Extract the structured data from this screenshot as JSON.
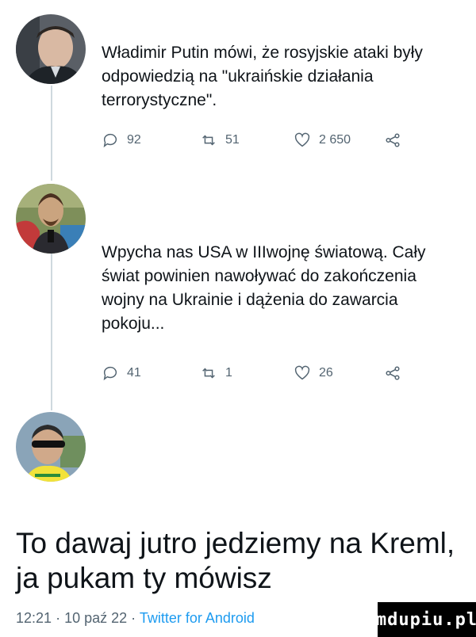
{
  "tweets": [
    {
      "text": "Władimir Putin mówi, że rosyjskie ataki były odpowiedzią na \"ukraińskie działania terrorystyczne\".",
      "replies": "92",
      "retweets": "51",
      "likes": "2 650",
      "share_icon": "share-icon"
    },
    {
      "text": "Wpycha nas USA w IIIwojnę światową. Cały świat powinien nawoływać do zakończenia wojny na Ukrainie i dążenia do zawarcia pokoju...",
      "replies": "41",
      "retweets": "1",
      "likes": "26",
      "share_icon": "share-icon"
    }
  ],
  "reply": {
    "text": "To dawaj jutro jedziemy na Kreml, ja pukam ty mówisz",
    "time": "12:21",
    "date": "10 paź 22",
    "source": "Twitter for Android"
  },
  "watermark": "mdupiu.pl",
  "colors": {
    "text": "#0f1419",
    "muted": "#536471",
    "link": "#1d9bf0",
    "thread": "#cfd9de"
  }
}
